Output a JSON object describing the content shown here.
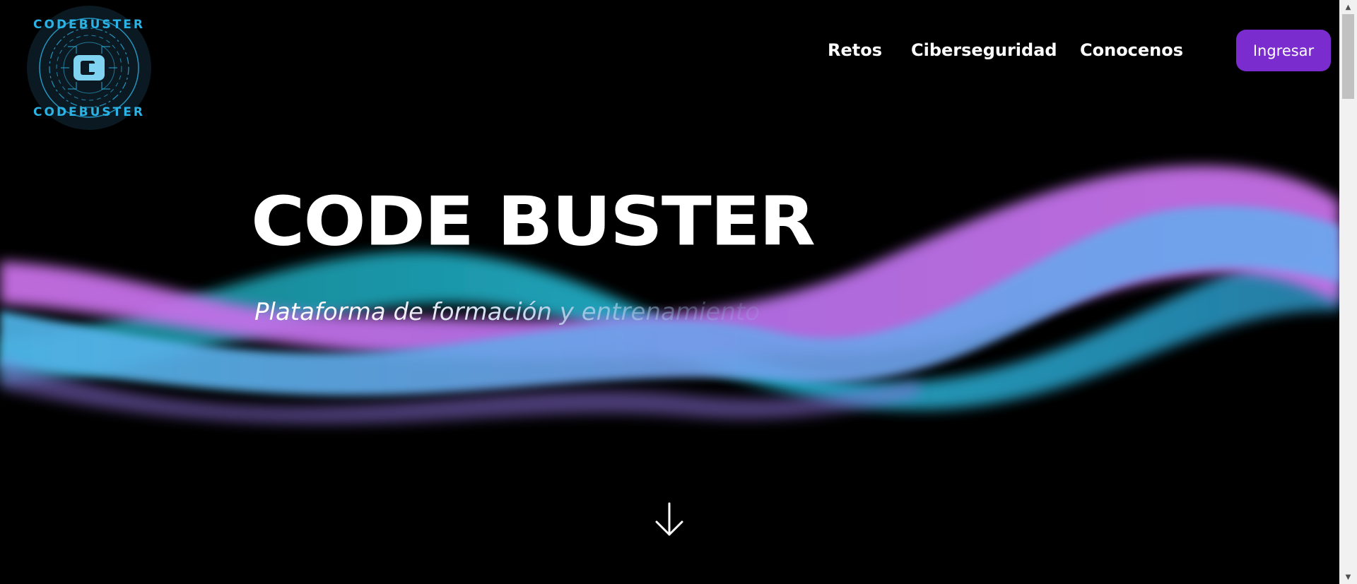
{
  "header": {
    "logo_text_top": "CODEBUSTER",
    "logo_text_bottom": "CODEBUSTER",
    "nav": [
      {
        "label": "Retos"
      },
      {
        "label": "Ciberseguridad"
      },
      {
        "label": "Conocenos"
      }
    ],
    "login_label": "Ingresar"
  },
  "hero": {
    "title": "CODE BUSTER",
    "subtitle": "Plataforma de formación y entrenamiento"
  },
  "colors": {
    "background": "#000000",
    "accent": "#7b2cce",
    "wave_pink": "#c86fe6",
    "wave_blue": "#6aa8ee",
    "wave_teal": "#21b5cf",
    "logo_cyan": "#2bb3e6"
  },
  "icons": {
    "scroll_down": "arrow-down-icon",
    "logo": "codebuster-logo"
  }
}
